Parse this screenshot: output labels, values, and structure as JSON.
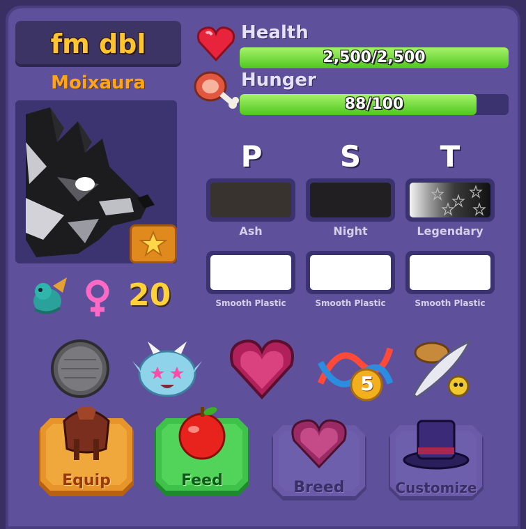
{
  "pet": {
    "name": "fm dbl",
    "species": "Moixaura",
    "level": "20",
    "gender_icon": "female-icon"
  },
  "stats": {
    "health": {
      "label": "Health",
      "text": "2,500/2,500",
      "fraction": 1.0,
      "icon": "heart-icon"
    },
    "hunger": {
      "label": "Hunger",
      "text": "88/100",
      "fraction": 0.88,
      "icon": "meat-icon"
    }
  },
  "traits": {
    "headers": [
      "P",
      "S",
      "T"
    ],
    "colors": [
      {
        "label": "Ash",
        "color": "#38332f"
      },
      {
        "label": "Night",
        "color": "#221f22"
      },
      {
        "label": "Legendary",
        "color": "legendary-gradient"
      }
    ],
    "materials": [
      {
        "label": "Smooth Plastic",
        "color": "#ffffff"
      },
      {
        "label": "Smooth Plastic",
        "color": "#ffffff"
      },
      {
        "label": "Smooth Plastic",
        "color": "#ffffff"
      }
    ]
  },
  "icons_row": [
    "metal-plate-icon",
    "blue-dragon-face-icon",
    "heart-gem-icon",
    "dna-5-icon",
    "feather-hat-icon"
  ],
  "actions": {
    "equip": "Equip",
    "feed": "Feed",
    "breed": "Breed",
    "customize": "Customize"
  },
  "colors": {
    "panel": "#5e509a",
    "health_bar": "#6fdc2e",
    "name": "#ffc531",
    "species": "#ffa41b"
  }
}
